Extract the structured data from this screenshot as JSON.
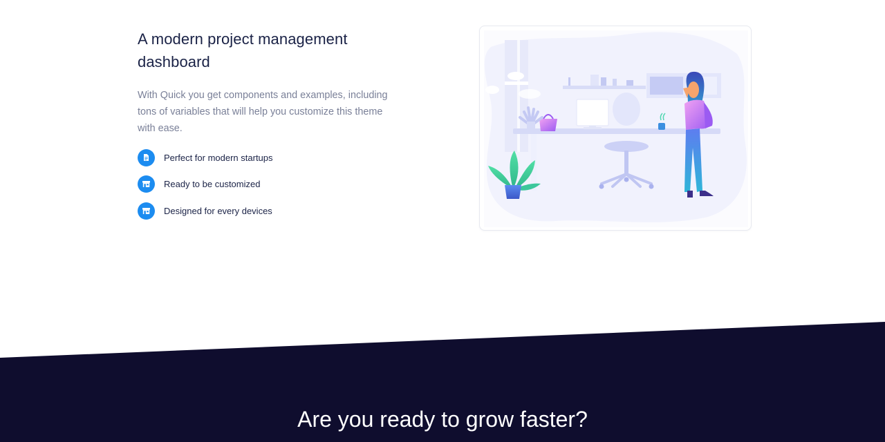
{
  "feature": {
    "title": "A modern project management dashboard",
    "lead": "With Quick you get components and examples, including tons of variables that will help you customize this theme with ease.",
    "items": [
      {
        "label": "Perfect for modern startups",
        "icon": "document-icon"
      },
      {
        "label": "Ready to be customized",
        "icon": "store-icon"
      },
      {
        "label": "Designed for every devices",
        "icon": "store-icon"
      }
    ]
  },
  "illustration": {
    "name": "office-workspace-illustration"
  },
  "cta": {
    "title": "Are you ready to grow faster?"
  },
  "colors": {
    "accent": "#1c8cf0",
    "heading": "#1a2246",
    "muted": "#7a8098",
    "dark_band": "#0f0d2e"
  }
}
